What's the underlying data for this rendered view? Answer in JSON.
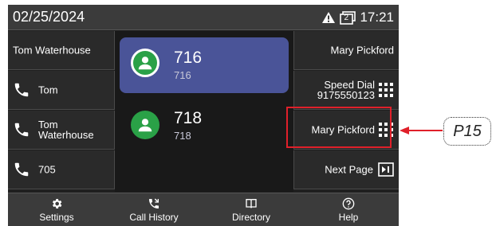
{
  "status_bar": {
    "date": "02/25/2024",
    "line_badge": "2",
    "time": "17:21"
  },
  "left_keys": [
    {
      "label": "Tom Waterhouse",
      "icon": ""
    },
    {
      "label": "Tom",
      "icon": "phone-icon"
    },
    {
      "label_line1": "Tom",
      "label_line2": "Waterhouse",
      "icon": "phone-icon"
    },
    {
      "label": "705",
      "icon": "phone-icon"
    }
  ],
  "center_lines": [
    {
      "number": "716",
      "sub": "716",
      "active": true
    },
    {
      "number": "718",
      "sub": "718",
      "active": false
    }
  ],
  "right_keys": [
    {
      "label": "Mary Pickford"
    },
    {
      "label_line1": "Speed Dial",
      "label_line2": "9175550123",
      "icon": "keypad-icon"
    },
    {
      "label": "Mary Pickford",
      "icon": "keypad-icon"
    },
    {
      "label": "Next Page",
      "icon": "next-page-icon"
    }
  ],
  "softkeys": [
    {
      "label": "Settings",
      "icon": "gear-icon"
    },
    {
      "label": "Call History",
      "icon": "call-history-icon"
    },
    {
      "label": "Directory",
      "icon": "book-icon"
    },
    {
      "label": "Help",
      "icon": "help-icon"
    }
  ],
  "callout": {
    "label": "P15",
    "color": "#e0202a"
  },
  "colors": {
    "active_line": "#4a5498",
    "avatar": "#2aa147",
    "status_bg": "#3b3b3b"
  }
}
